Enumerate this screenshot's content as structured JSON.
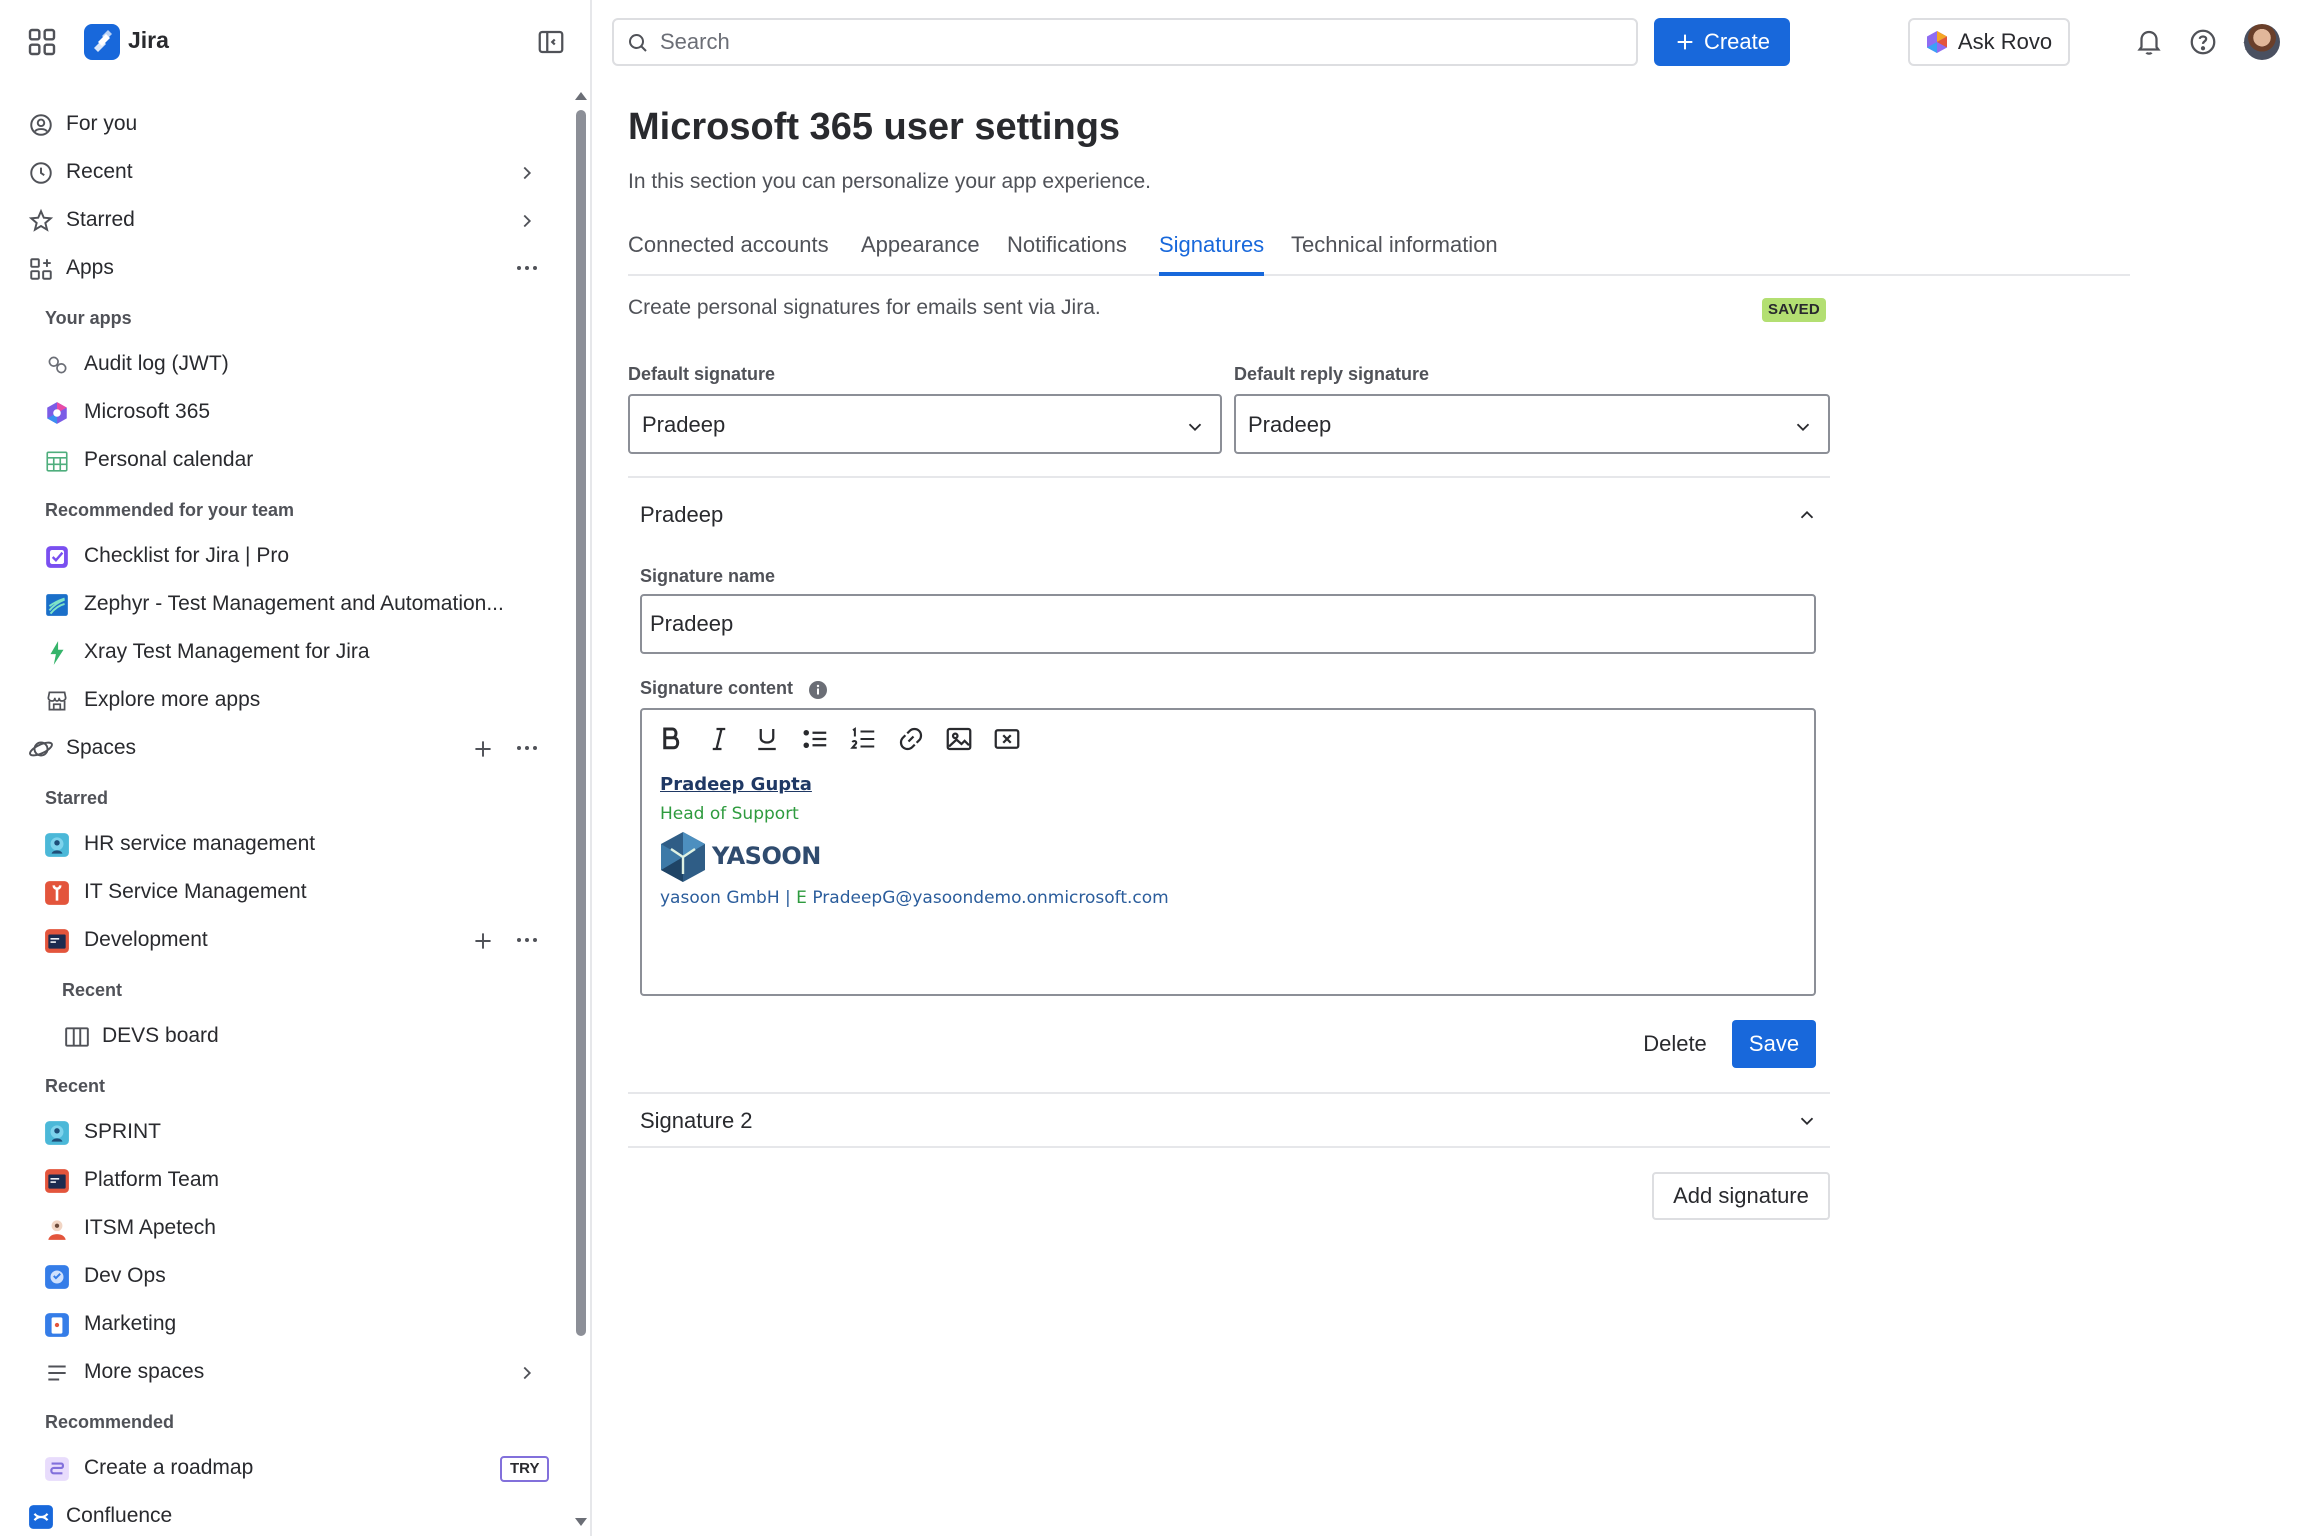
{
  "sidebar": {
    "product_name": "Jira",
    "top_items": [
      {
        "label": "For you"
      },
      {
        "label": "Recent"
      },
      {
        "label": "Starred"
      },
      {
        "label": "Apps"
      }
    ],
    "your_apps_heading": "Your apps",
    "your_apps": [
      {
        "label": "Audit log (JWT)"
      },
      {
        "label": "Microsoft 365"
      },
      {
        "label": "Personal calendar"
      }
    ],
    "recommended_team_heading": "Recommended for your team",
    "recommended_team_apps": [
      {
        "label": "Checklist for Jira | Pro"
      },
      {
        "label": "Zephyr - Test Management and Automation..."
      },
      {
        "label": "Xray Test Management for Jira"
      },
      {
        "label": "Explore more apps"
      }
    ],
    "spaces_label": "Spaces",
    "starred_heading": "Starred",
    "starred_spaces": [
      {
        "label": "HR service management",
        "color": "#4bb8d8"
      },
      {
        "label": "IT Service Management",
        "color": "#e3553c"
      },
      {
        "label": "Development",
        "color": "#e3553c"
      }
    ],
    "dev_recent_heading": "Recent",
    "dev_board": "DEVS board",
    "recent_heading": "Recent",
    "recent_spaces": [
      {
        "label": "SPRINT",
        "color": "#4bb8d8"
      },
      {
        "label": "Platform Team",
        "color": "#e3553c"
      },
      {
        "label": "ITSM Apetech",
        "color": "#f1d5c4"
      },
      {
        "label": "Dev Ops",
        "color": "#357de8"
      },
      {
        "label": "Marketing",
        "color": "#357de8"
      }
    ],
    "more_spaces": "More spaces",
    "recommended_heading": "Recommended",
    "create_roadmap": "Create a roadmap",
    "try_badge": "TRY",
    "confluence": "Confluence"
  },
  "topbar": {
    "search_placeholder": "Search",
    "create_label": "Create",
    "ask_rovo_label": "Ask Rovo"
  },
  "main": {
    "title": "Microsoft 365 user settings",
    "subtitle": "In this section you can personalize your app experience.",
    "tabs": [
      {
        "label": "Connected accounts"
      },
      {
        "label": "Appearance"
      },
      {
        "label": "Notifications"
      },
      {
        "label": "Signatures",
        "active": true
      },
      {
        "label": "Technical information"
      }
    ],
    "description": "Create personal signatures for emails sent via Jira.",
    "saved_badge": "SAVED",
    "default_signature_label": "Default signature",
    "default_signature_value": "Pradeep",
    "default_reply_label": "Default reply signature",
    "default_reply_value": "Pradeep",
    "signature1": {
      "header": "Pradeep",
      "name_label": "Signature name",
      "name_value": "Pradeep",
      "content_label": "Signature content",
      "content": {
        "name": "Pradeep Gupta",
        "role": "Head of Support",
        "logo_text": "YASOON",
        "company": "yasoon GmbH",
        "separator": "|",
        "email_prefix": "E",
        "email": "PradeepG@yasoondemo.onmicrosoft.com"
      },
      "delete_label": "Delete",
      "save_label": "Save"
    },
    "signature2_header": "Signature 2",
    "add_signature_label": "Add signature"
  },
  "colors": {
    "brand_blue": "#1868db",
    "saved_green": "#b3df72",
    "signature_green": "#2e9b3e",
    "signature_navy": "#1f3864"
  }
}
